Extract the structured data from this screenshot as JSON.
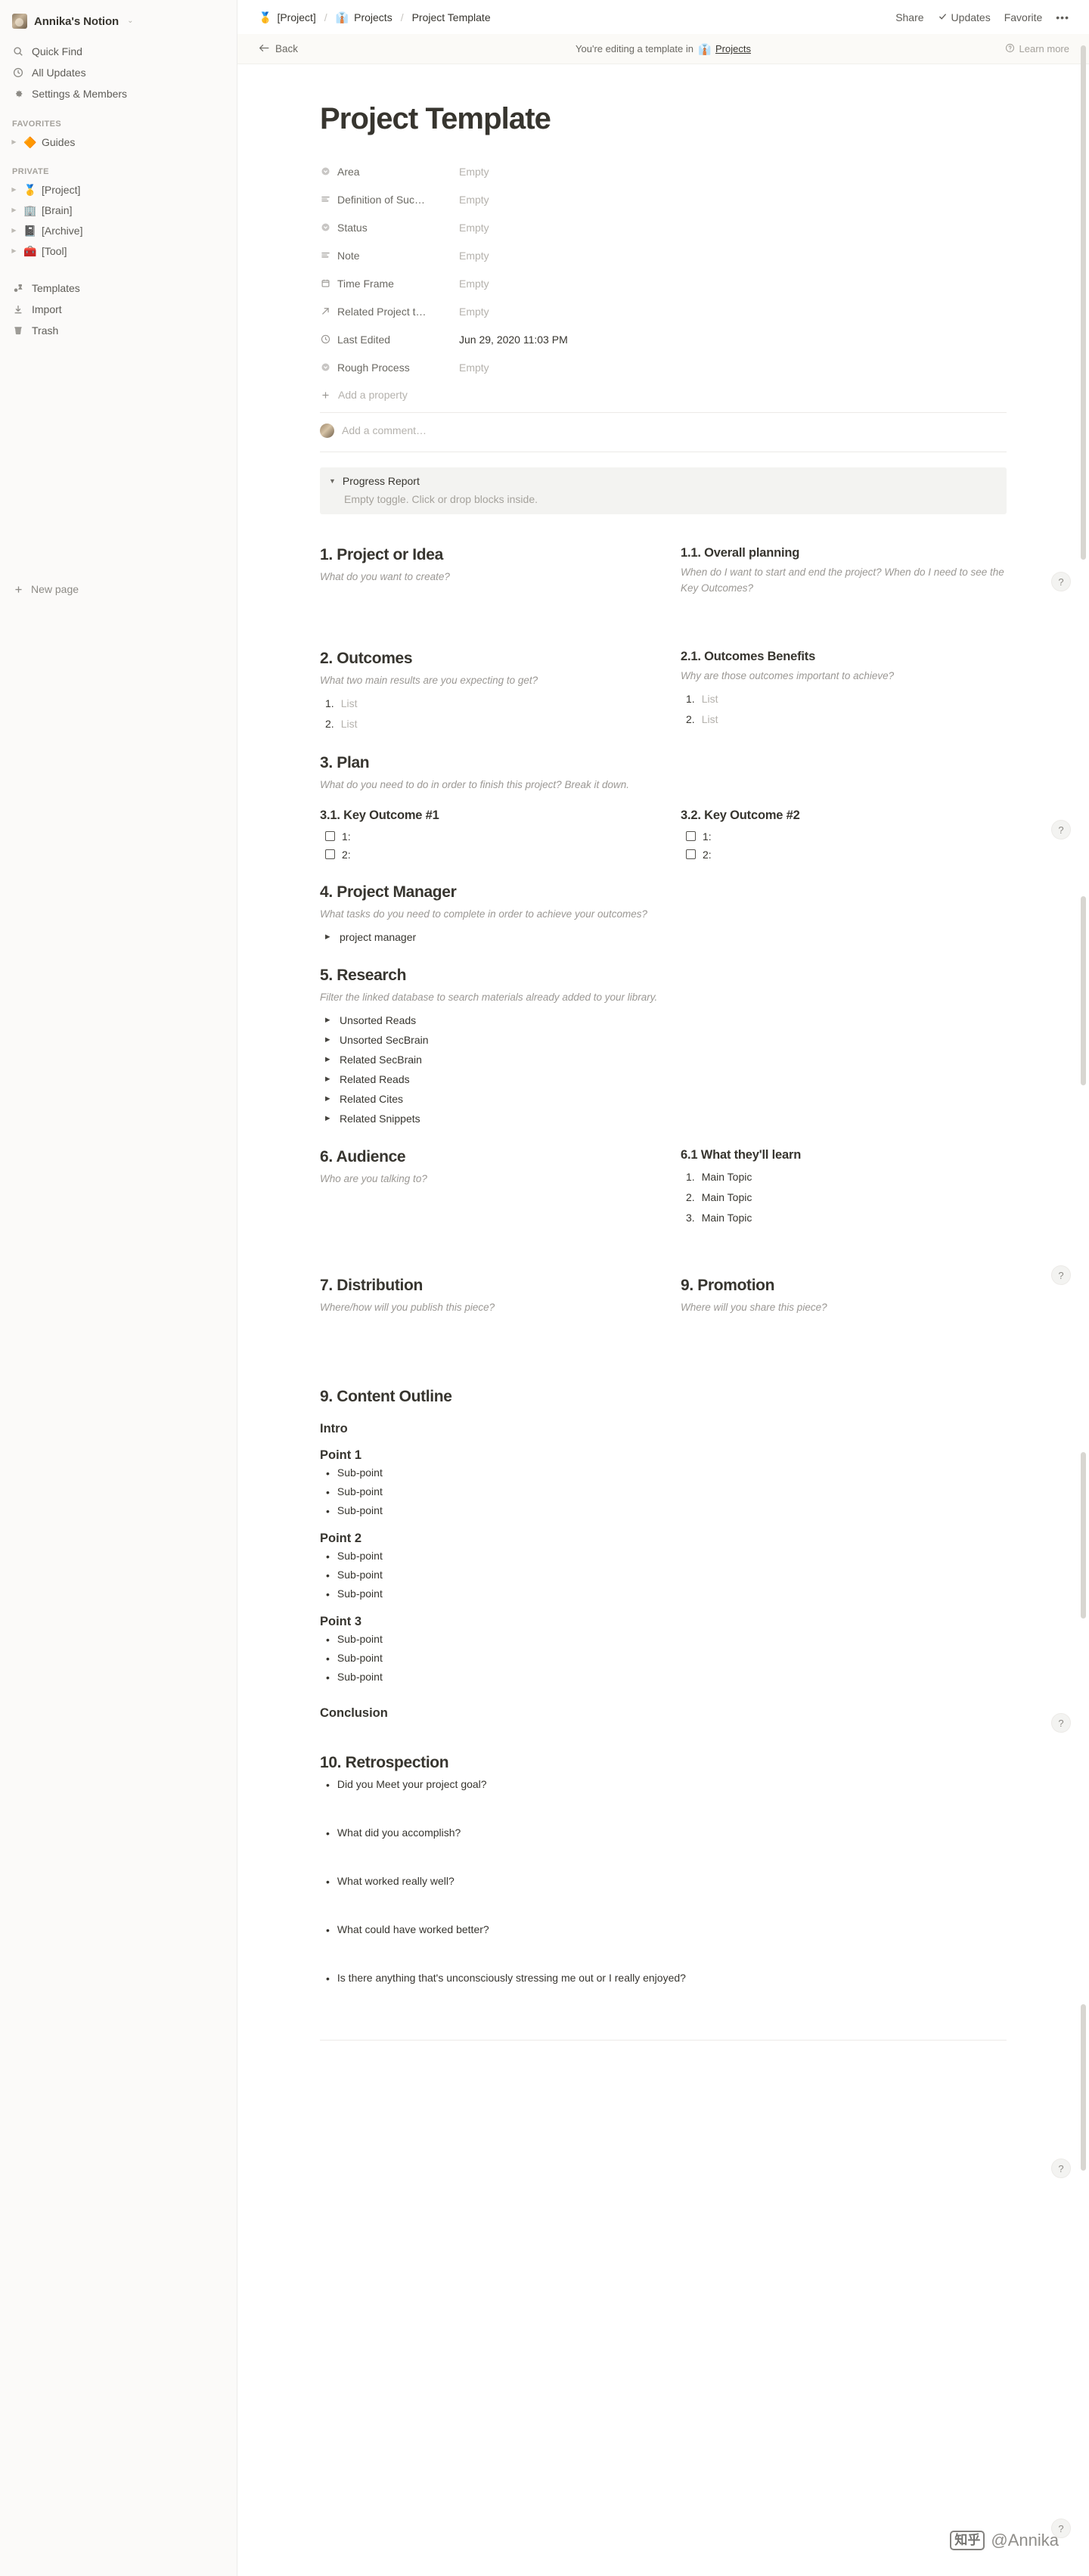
{
  "sidebar": {
    "workspace": {
      "name": "Annika's Notion",
      "caret": "⌃⌄"
    },
    "nav": [
      {
        "label": "Quick Find",
        "icon": "search-icon"
      },
      {
        "label": "All Updates",
        "icon": "clock-icon"
      },
      {
        "label": "Settings & Members",
        "icon": "gear-icon"
      }
    ],
    "favorites_label": "FAVORITES",
    "favorites": [
      {
        "label": "Guides",
        "emoji": "🔶"
      }
    ],
    "private_label": "PRIVATE",
    "private": [
      {
        "label": "[Project]",
        "emoji": "🥇"
      },
      {
        "label": "[Brain]",
        "emoji": "🏢"
      },
      {
        "label": "[Archive]",
        "emoji": "📓"
      },
      {
        "label": "[Tool]",
        "emoji": "🧰"
      }
    ],
    "bottom": [
      {
        "label": "Templates",
        "icon": "templates-icon"
      },
      {
        "label": "Import",
        "icon": "import-icon"
      },
      {
        "label": "Trash",
        "icon": "trash-icon"
      }
    ],
    "new_page": "New page"
  },
  "topbar": {
    "breadcrumb": [
      {
        "emoji": "🥇",
        "label": "[Project]"
      },
      {
        "emoji": "👔",
        "label": "Projects"
      },
      {
        "emoji": "",
        "label": "Project Template"
      }
    ],
    "separator": "/",
    "share": "Share",
    "updates": "Updates",
    "favorite": "Favorite",
    "more": "•••"
  },
  "banner": {
    "back": "Back",
    "message": "You're editing a template in",
    "db_emoji": "👔",
    "db_name": "Projects",
    "learn_more": "Learn more"
  },
  "page": {
    "title": "Project Template",
    "properties": [
      {
        "icon": "select-icon",
        "name": "Area",
        "value": "Empty",
        "filled": false
      },
      {
        "icon": "text-icon",
        "name": "Definition of Suc…",
        "value": "Empty",
        "filled": false
      },
      {
        "icon": "select-icon",
        "name": "Status",
        "value": "Empty",
        "filled": false
      },
      {
        "icon": "text-icon",
        "name": "Note",
        "value": "Empty",
        "filled": false
      },
      {
        "icon": "date-icon",
        "name": "Time Frame",
        "value": "Empty",
        "filled": false
      },
      {
        "icon": "relation-icon",
        "name": "Related Project t…",
        "value": "Empty",
        "filled": false
      },
      {
        "icon": "clock-icon",
        "name": "Last Edited",
        "value": "Jun 29, 2020 11:03 PM",
        "filled": true
      },
      {
        "icon": "select-icon",
        "name": "Rough Process",
        "value": "Empty",
        "filled": false
      }
    ],
    "add_property": "Add a property",
    "add_comment": "Add a comment…",
    "progress_toggle": {
      "title": "Progress Report",
      "empty_text": "Empty toggle. Click or drop blocks inside."
    },
    "sections": {
      "s1": {
        "heading": "1. Project or Idea",
        "hint": "What do you want to create?"
      },
      "s1_1": {
        "heading": "1.1. Overall planning",
        "hint": "When do I want to start and end the project? When do I need to see the Key Outcomes?"
      },
      "s2": {
        "heading": "2. Outcomes",
        "hint": "What two main results are you expecting to get?",
        "items": [
          "List",
          "List"
        ]
      },
      "s2_1": {
        "heading": "2.1. Outcomes Benefits",
        "hint": "Why are those outcomes important to achieve?",
        "items": [
          "List",
          "List"
        ]
      },
      "s3": {
        "heading": "3. Plan",
        "hint": "What do you need to do in order to finish this project? Break it down."
      },
      "s3_1": {
        "heading": "3.1. Key Outcome #1",
        "todos": [
          "1:",
          "2:"
        ]
      },
      "s3_2": {
        "heading": "3.2. Key Outcome #2",
        "todos": [
          "1:",
          "2:"
        ]
      },
      "s4": {
        "heading": "4. Project Manager",
        "hint": "What tasks do you need to complete in order to achieve your outcomes?",
        "toggles": [
          "project manager"
        ]
      },
      "s5": {
        "heading": "5. Research",
        "hint": "Filter the linked database to search materials already added to your library.",
        "toggles": [
          "Unsorted Reads",
          "Unsorted SecBrain",
          "Related SecBrain",
          "Related Reads",
          "Related Cites",
          "Related Snippets"
        ]
      },
      "s6": {
        "heading": "6. Audience",
        "hint": "Who are you talking to?"
      },
      "s6_1": {
        "heading": "6.1 What they'll learn",
        "items": [
          "Main Topic",
          "Main Topic",
          "Main Topic"
        ]
      },
      "s7": {
        "heading": "7. Distribution",
        "hint": "Where/how will you publish this piece?"
      },
      "s9p": {
        "heading": "9. Promotion",
        "hint": "Where will you share this piece?"
      },
      "s9": {
        "heading": "9. Content Outline",
        "intro": "Intro",
        "points": [
          {
            "title": "Point 1",
            "sub": [
              "Sub-point",
              "Sub-point",
              "Sub-point"
            ]
          },
          {
            "title": "Point 2",
            "sub": [
              "Sub-point",
              "Sub-point",
              "Sub-point"
            ]
          },
          {
            "title": "Point 3",
            "sub": [
              "Sub-point",
              "Sub-point",
              "Sub-point"
            ]
          }
        ],
        "conclusion": "Conclusion"
      },
      "s10": {
        "heading": "10. Retrospection",
        "items": [
          "Did you Meet your project goal?",
          "What did you accomplish?",
          "What worked really well?",
          "What could have worked better?",
          "Is there anything that's unconsciously stressing me out or I really enjoyed?"
        ]
      }
    }
  },
  "help_badge": "?",
  "watermark": {
    "logo": "知乎",
    "text": "@Annika"
  }
}
